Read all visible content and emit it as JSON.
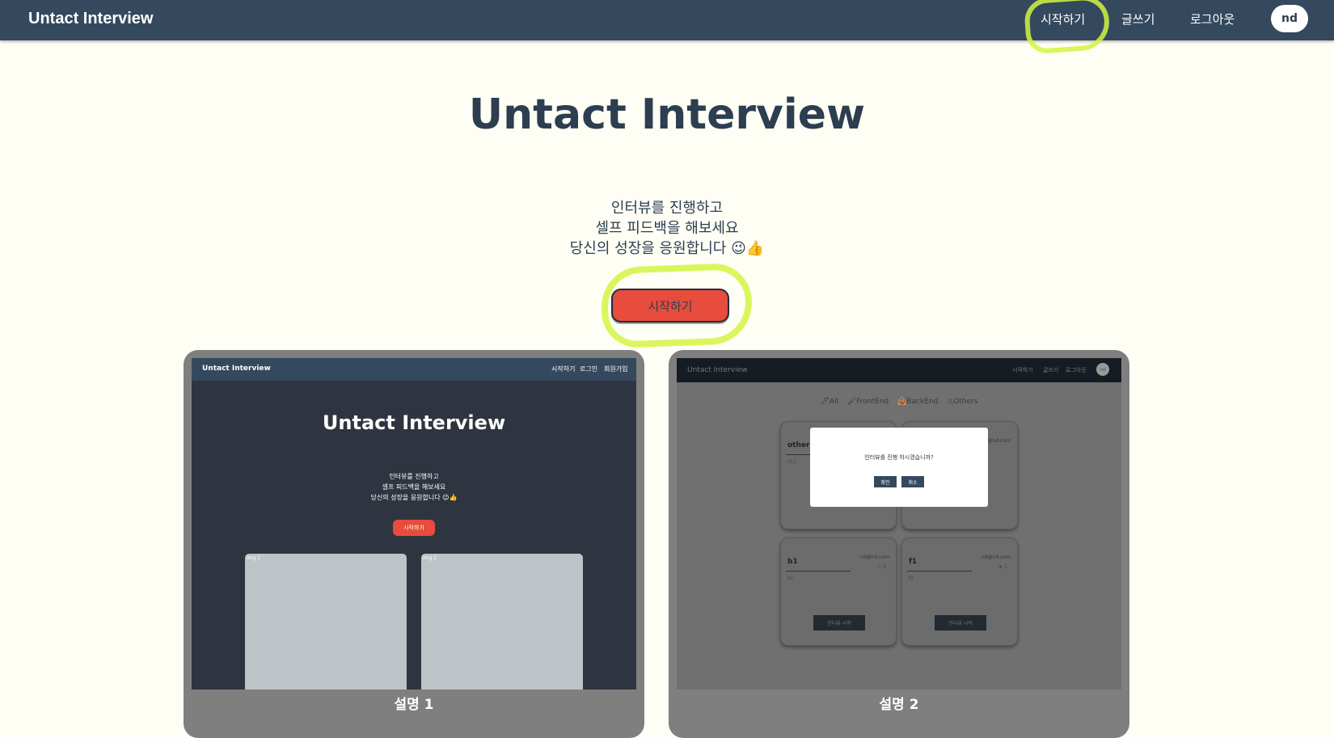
{
  "navbar": {
    "brand": "Untact Interview",
    "links": [
      "시작하기",
      "글쓰기",
      "로그아웃"
    ],
    "avatar": "nd"
  },
  "hero": {
    "title": "Untact Interview",
    "lines": [
      "인터뷰를 진행하고",
      "셀프 피드백을 해보세요",
      "당신의 성장을 응원합니다"
    ],
    "emoji": "😉👍",
    "start_button": "시작하기"
  },
  "cards": [
    {
      "caption": "설명 1",
      "shot": {
        "brand": "Untact Interview",
        "links": [
          "시작하기",
          "로그인",
          "회원가입"
        ],
        "title": "Untact Interview",
        "lines": [
          "인터뷰를 진행하고",
          "셀프 피드백을 해보세요",
          "당신의 성장을 응원합니다 😉👍"
        ],
        "button": "시작하기",
        "panels": [
          "img 1",
          "img 2"
        ]
      }
    },
    {
      "caption": "설명 2",
      "shot": {
        "brand": "Untact Interview",
        "links": [
          "시작하기",
          "글쓰기",
          "로그아웃"
        ],
        "avatar": "nd",
        "filters": [
          "🖊All",
          "🖌FrontEnd",
          "👜BackEnd",
          "⚠Others"
        ],
        "posts": [
          {
            "title": "other11",
            "email": "",
            "meta": "",
            "body": "o11",
            "button": ""
          },
          {
            "title": "",
            "email": "nd@nd.com",
            "meta": "",
            "body": "",
            "button": ""
          },
          {
            "title": "b1",
            "email": "nd@nd.com",
            "meta": "☆ 0",
            "body": "b1",
            "button": "인터뷰 시작"
          },
          {
            "title": "f1",
            "email": "nd@nd.com",
            "meta": "★ 1",
            "body": "f1",
            "button": "인터뷰 시작"
          }
        ],
        "modal": {
          "text": "인터뷰를 진행 하시겠습니까?",
          "ok": "확인",
          "cancel": "취소"
        }
      }
    }
  ],
  "colors": {
    "navbar": "#34495e",
    "background": "#fefef5",
    "accent": "#e74c3c",
    "highlight": "#d4f542"
  }
}
